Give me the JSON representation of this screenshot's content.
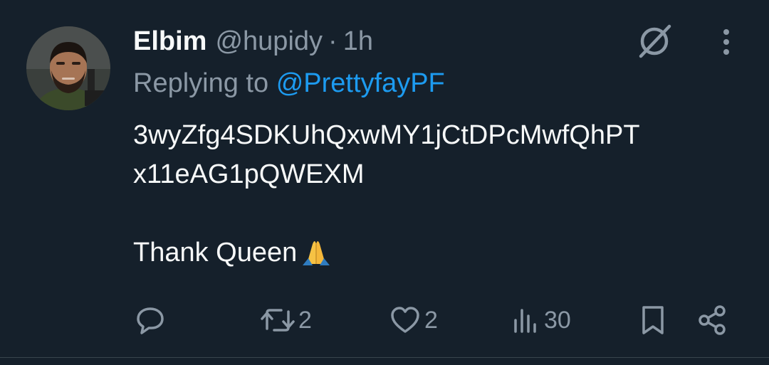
{
  "author": {
    "name": "Elbim",
    "handle": "@hupidy",
    "separator": "·",
    "time": "1h"
  },
  "reply": {
    "prefix": "Replying to",
    "mention": "@PrettyfayPF"
  },
  "body": {
    "line1": "3wyZfg4SDKUhQxwMY1jCtDPcMwfQhPT",
    "line2": "x11eAG1pQWEXM",
    "line3": "Thank Queen"
  },
  "icons": {
    "grok": "grok-icon",
    "more": "more-vertical-icon",
    "reply": "reply-icon",
    "retweet": "retweet-icon",
    "like": "heart-icon",
    "views": "views-icon",
    "bookmark": "bookmark-icon",
    "share": "share-icon",
    "emoji": "folded-hands-emoji"
  },
  "stats": {
    "retweets": "2",
    "likes": "2",
    "views": "30"
  },
  "colors": {
    "background": "#15202b",
    "text": "#f7f9f9",
    "secondary": "#8b98a5",
    "link": "#1d9bf0",
    "divider": "#38444d"
  }
}
